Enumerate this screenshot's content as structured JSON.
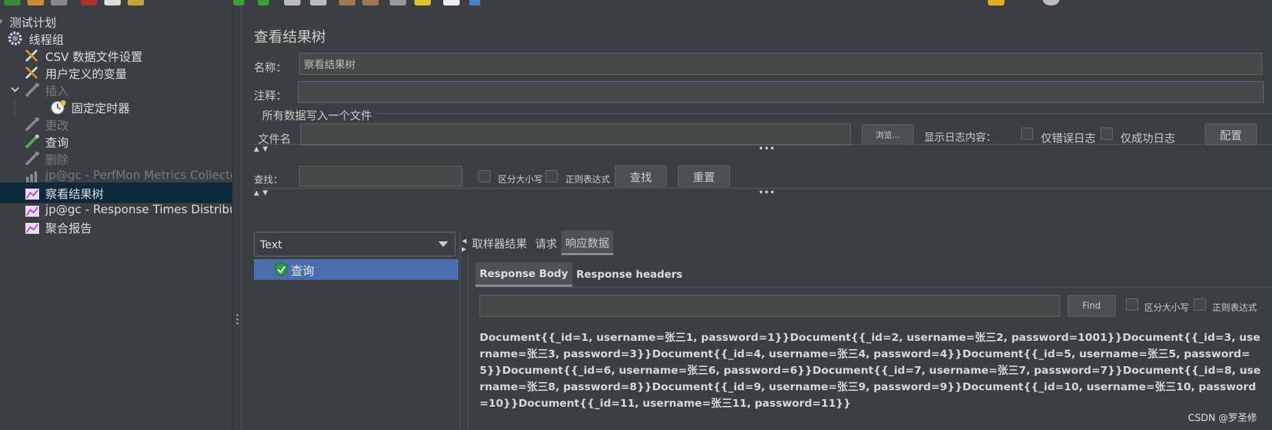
{
  "tree": {
    "items": [
      {
        "label": "测试计划",
        "icon": "test-plan-icon"
      },
      {
        "label": "线程组",
        "icon": "gear-icon"
      },
      {
        "label": "CSV 数据文件设置",
        "icon": "wrench-icon"
      },
      {
        "label": "用户定义的变量",
        "icon": "wrench-icon"
      },
      {
        "label": "插入",
        "icon": "pipette-icon"
      },
      {
        "label": "固定定时器",
        "icon": "stopwatch-icon"
      },
      {
        "label": "更改",
        "icon": "pipette-icon"
      },
      {
        "label": "查询",
        "icon": "pipette-icon"
      },
      {
        "label": "删除",
        "icon": "pipette-icon"
      },
      {
        "label": "jp@gc - PerfMon Metrics Collector",
        "icon": "chart-icon"
      },
      {
        "label": "察看结果树",
        "icon": "chart-icon"
      },
      {
        "label": "jp@gc - Response Times Distribution",
        "icon": "chart-icon"
      },
      {
        "label": "聚合报告",
        "icon": "chart-icon"
      }
    ]
  },
  "panel": {
    "title": "查看结果树",
    "name_label": "名称：",
    "name_value": "察看结果树",
    "comment_label": "注释：",
    "comment_value": "",
    "file_group_label": "所有数据写入一个文件",
    "filename_label": "文件名",
    "filename_value": "",
    "browse_label": "浏览...",
    "log_content_label": "显示日志内容：",
    "errors_only_label": "仅错误日志",
    "success_only_label": "仅成功日志",
    "configure_label": "配置",
    "search_label": "查找：",
    "search_value": "",
    "case_sensitive_label": "区分大小写",
    "regex_label": "正则表达式",
    "find_button_label": "查找",
    "reset_button_label": "重置"
  },
  "results": {
    "renderer": "Text",
    "items": [
      {
        "label": "查询",
        "status": "success"
      }
    ],
    "tabs": [
      "取样器结果",
      "请求",
      "响应数据"
    ],
    "active_tab": "响应数据",
    "subtabs": [
      "Response Body",
      "Response headers"
    ],
    "active_subtab": "Response Body",
    "find_value": "",
    "find_label": "Find",
    "case_sensitive_label": "区分大小写",
    "regex_label": "正则表达式",
    "body": "Document{{_id=1, username=张三1, password=1}}Document{{_id=2, username=张三2, password=1001}}Document{{_id=3, username=张三3, password=3}}Document{{_id=4, username=张三4, password=4}}Document{{_id=5, username=张三5, password=5}}Document{{_id=6, username=张三6, password=6}}Document{{_id=7, username=张三7, password=7}}Document{{_id=8, username=张三8, password=8}}Document{{_id=9, username=张三9, password=9}}Document{{_id=10, username=张三10, password=10}}Document{{_id=11, username=张三11, password=11}}"
  },
  "watermark": "CSDN @罗圣修",
  "colors": {
    "background": "#3c3f41",
    "selected_tree": "#0d293e",
    "selected_result": "#4b6eaf",
    "success_icon": "#2e9e3e"
  }
}
